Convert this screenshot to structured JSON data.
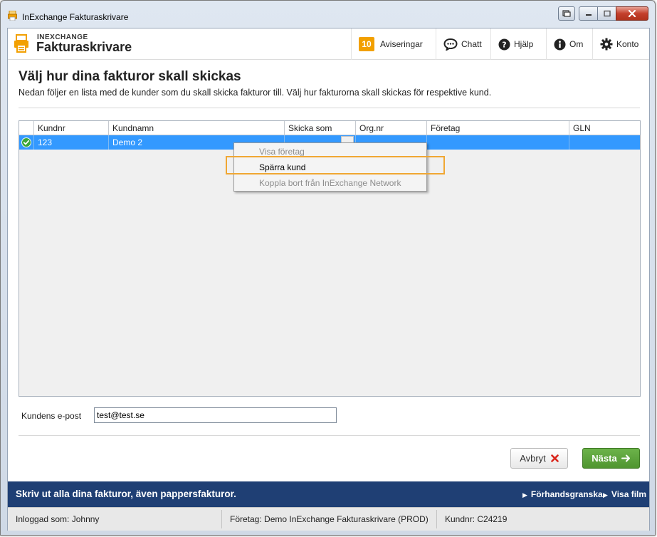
{
  "window": {
    "title": "InExchange Fakturaskrivare"
  },
  "header": {
    "brand_top": "INEXCHANGE",
    "brand_main": "Fakturaskrivare",
    "nav": {
      "notifications_count": "10",
      "notifications_label": "Aviseringar",
      "chat_label": "Chatt",
      "help_label": "Hjälp",
      "about_label": "Om",
      "account_label": "Konto"
    }
  },
  "main": {
    "title": "Välj hur dina fakturor skall skickas",
    "subtitle": "Nedan följer en lista med de kunder som du skall skicka fakturor till. Välj hur fakturorna skall skickas för respektive kund."
  },
  "grid": {
    "columns": [
      "Kundnr",
      "Kundnamn",
      "Skicka som",
      "Org.nr",
      "Företag",
      "GLN"
    ],
    "rows": [
      {
        "status": "check-circle-icon",
        "kundnr": "123",
        "kundnamn": "Demo 2",
        "skicka_som": "",
        "orgnr": "",
        "foretag": "",
        "gln": ""
      }
    ]
  },
  "context_menu": {
    "items": [
      {
        "label": "Visa företag",
        "enabled": false
      },
      {
        "label": "Spärra kund",
        "enabled": true
      },
      {
        "label": "Koppla bort från InExchange Network",
        "enabled": false
      }
    ]
  },
  "email": {
    "label": "Kundens e-post",
    "value": "test@test.se"
  },
  "actions": {
    "cancel_label": "Avbryt",
    "next_label": "Nästa"
  },
  "banner": {
    "text": "Skriv ut alla dina fakturor, även pappersfakturor.",
    "preview_label": "Förhandsgranska",
    "video_label": "Visa film"
  },
  "status": {
    "logged_in": "Inloggad som: Johnny",
    "company": "Företag: Demo InExchange Fakturaskrivare (PROD)",
    "customer_no": "Kundnr: C24219"
  },
  "colors": {
    "accent_orange": "#f2a000",
    "selection_blue": "#3399ff",
    "banner_navy": "#1f3f74",
    "next_green": "#5aa33b",
    "cancel_red": "#d9261c"
  }
}
